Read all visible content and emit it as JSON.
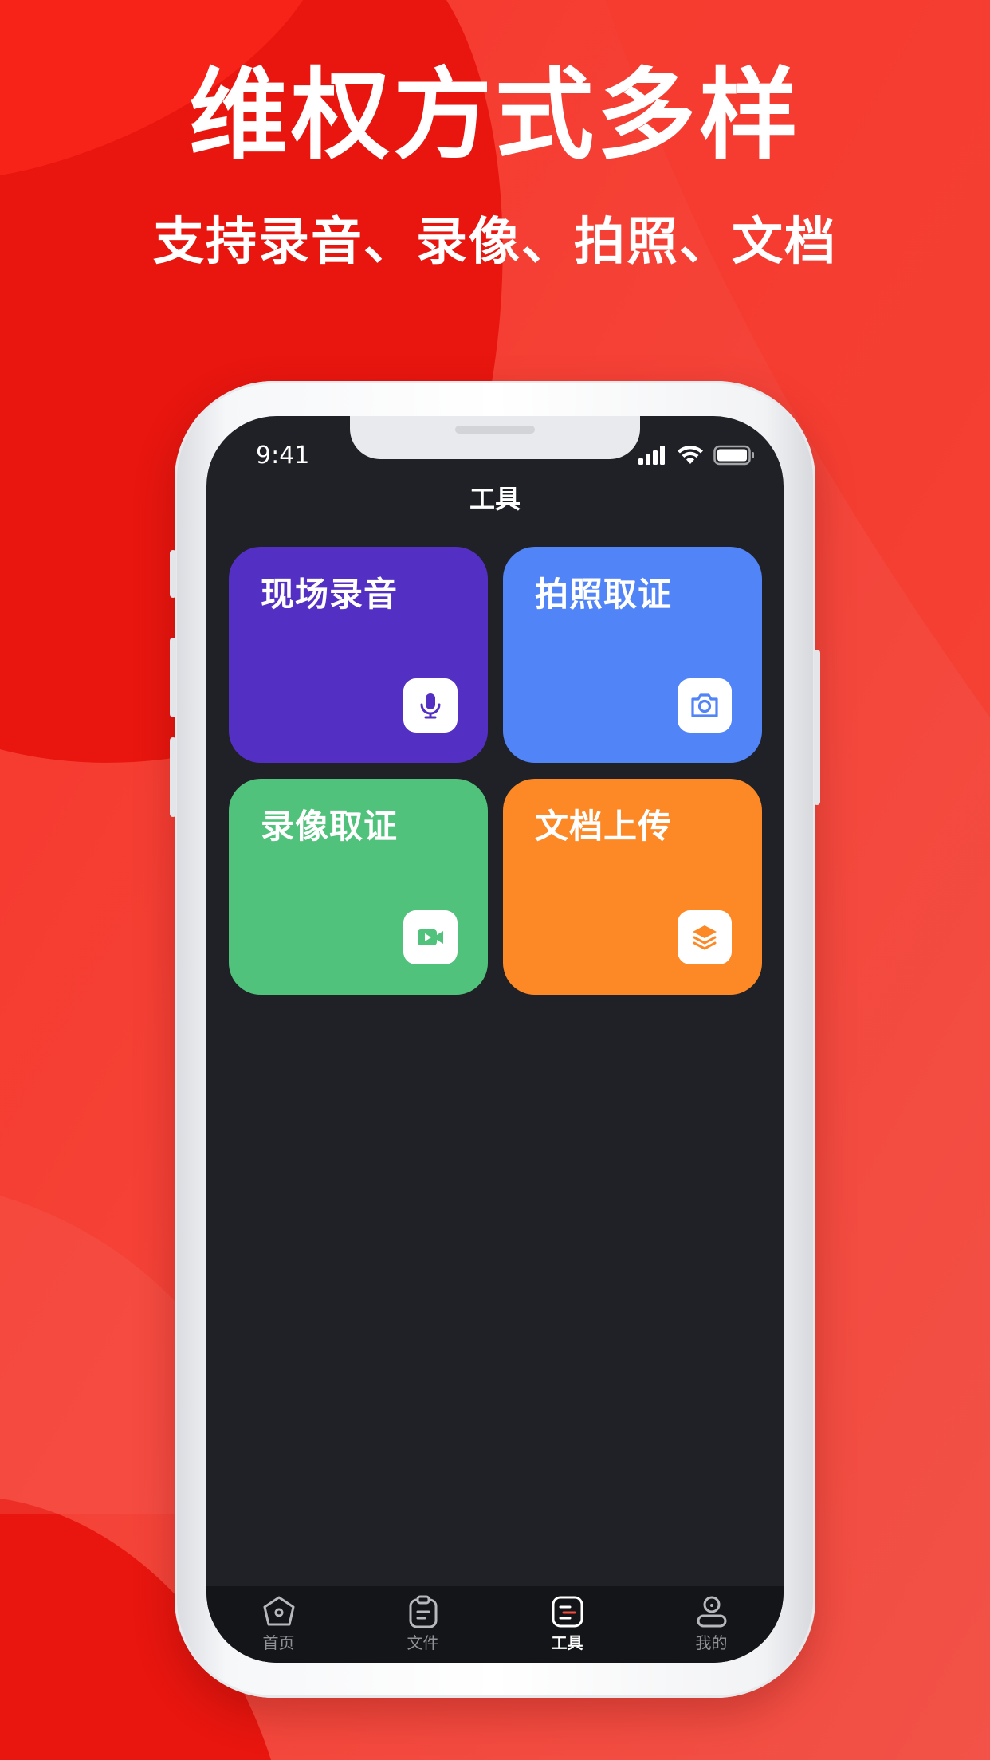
{
  "hero": {
    "title": "维权方式多样",
    "subtitle": "支持录音、录像、拍照、文档"
  },
  "status_bar": {
    "time": "9:41"
  },
  "header": {
    "title": "工具"
  },
  "tools": [
    {
      "label": "现场录音",
      "icon": "microphone-icon",
      "color": "#5330c3"
    },
    {
      "label": "拍照取证",
      "icon": "camera-icon",
      "color": "#5084f7"
    },
    {
      "label": "录像取证",
      "icon": "video-icon",
      "color": "#50c27b"
    },
    {
      "label": "文档上传",
      "icon": "layers-icon",
      "color": "#fd8826"
    }
  ],
  "tabbar": {
    "items": [
      {
        "label": "首页",
        "icon": "home-icon",
        "active": false
      },
      {
        "label": "文件",
        "icon": "clipboard-icon",
        "active": false
      },
      {
        "label": "工具",
        "icon": "tools-icon",
        "active": true
      },
      {
        "label": "我的",
        "icon": "profile-icon",
        "active": false
      }
    ]
  },
  "colors": {
    "background": "#f24a3e",
    "screen": "#1f2126",
    "tabbar": "#141518",
    "active_accent": "#f24a3e"
  }
}
